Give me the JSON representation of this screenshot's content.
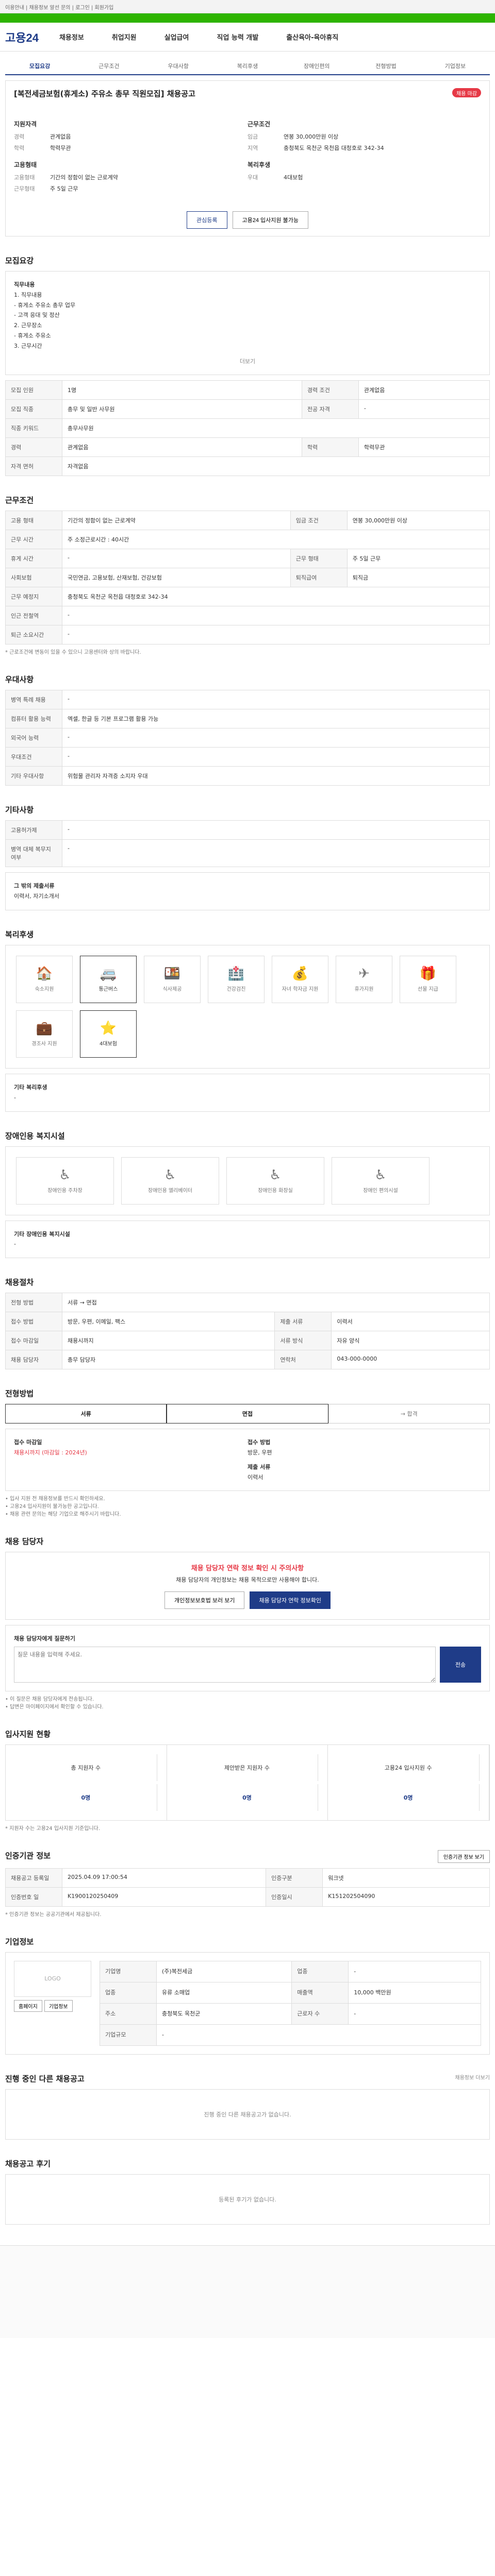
{
  "topbar": {
    "text": "이용안내 | 채용정보 알선 문의 | 로그인 | 회원가입"
  },
  "header": {
    "logo": "고용24",
    "gnb": [
      "채용정보",
      "취업지원",
      "실업급여",
      "직업 능력 개발",
      "출산육아-육아휴직"
    ]
  },
  "tabs": [
    "모집요강",
    "근무조건",
    "우대사항",
    "복리후생",
    "장애인편의",
    "전형방법",
    "기업정보"
  ],
  "job": {
    "title": "[복전세금보험(휴게소) 주유소 총무 직원모집] 채용공고",
    "badge": "채용 마감",
    "summary_left_head": "지원자격",
    "summary_left": [
      {
        "k": "경력",
        "v": "관계없음"
      },
      {
        "k": "학력",
        "v": "학력무관"
      }
    ],
    "summary_right_head": "근무조건",
    "summary_right": [
      {
        "k": "임금",
        "v": "연봉 30,000만원 이상"
      },
      {
        "k": "지역",
        "v": "충청북도 옥천군 옥천읍 대청호로 342-34"
      }
    ],
    "summary_left2_head": "고용형태",
    "summary_left2": [
      {
        "k": "고용형태",
        "v": "기간의 정함이 없는 근로계약"
      },
      {
        "k": "근무형태",
        "v": "주 5일 근무"
      }
    ],
    "summary_right2_head": "복리후생",
    "summary_right2": [
      {
        "k": "우대",
        "v": "4대보험"
      }
    ],
    "btn_save": "관심등록",
    "btn_apply": "고용24 입사지원 불가능"
  },
  "recruit": {
    "title": "모집요강",
    "duties_head": "직무내용",
    "duties": [
      "1. 직무내용",
      "- 휴게소 주유소 총무 업무",
      "- 고객 응대 및 정산",
      "2. 근무장소",
      "- 휴게소 주유소",
      "3. 근무시간"
    ],
    "toggle": "더보기",
    "rows": [
      {
        "k": "모집 인원",
        "v": "1명",
        "k2": "경력 조건",
        "v2": "관계없음"
      },
      {
        "k": "모집 직종",
        "v": "총무 및 일반 사무원",
        "k2": "전공 자격",
        "v2": "-"
      },
      {
        "k": "직종 키워드",
        "v": "총무사무원",
        "k2": "",
        "v2": ""
      },
      {
        "k": "경력",
        "v": "관계없음",
        "k2": "학력",
        "v2": "학력무관"
      },
      {
        "k": "자격 면허",
        "v": "자격없음",
        "k2": "",
        "v2": ""
      }
    ]
  },
  "conditions": {
    "title": "근무조건",
    "rows": [
      {
        "k": "고용 형태",
        "v": "기간의 정함이 없는 근로계약",
        "k2": "임금 조건",
        "v2": "연봉 30,000만원 이상"
      },
      {
        "k": "근무 시간",
        "v": "주 소정근로시간 : 40시간",
        "k2": "",
        "v2": ""
      },
      {
        "k": "휴게 시간",
        "v": "-",
        "k2": "근무 형태",
        "v2": "주 5일 근무"
      },
      {
        "k": "사회보험",
        "v": "국민연금, 고용보험, 산재보험, 건강보험",
        "k2": "퇴직급여",
        "v2": "퇴직금"
      },
      {
        "k": "근무 예정지",
        "v": "충청북도 옥천군 옥천읍 대청호로 342-34",
        "k2": "",
        "v2": ""
      },
      {
        "k": "인근 전철역",
        "v": "-",
        "k2": "",
        "v2": ""
      },
      {
        "k": "퇴근 소요시간",
        "v": "-",
        "k2": "",
        "v2": ""
      }
    ],
    "note": "* 근로조건에 변동이 있을 수 있으니 고용센터와 상의 바랍니다."
  },
  "prefer": {
    "title": "우대사항",
    "rows": [
      {
        "k": "병역 특례 채용",
        "v": "-"
      },
      {
        "k": "컴퓨터 활용 능력",
        "v": "엑셀, 한글 등 기본 프로그램 활용 가능"
      },
      {
        "k": "외국어 능력",
        "v": "-"
      },
      {
        "k": "우대조건",
        "v": "-"
      },
      {
        "k": "기타 우대사항",
        "v": "위험물 관리자 자격증 소지자 우대"
      }
    ]
  },
  "other": {
    "title": "기타사항",
    "rows": [
      {
        "k": "고용허가제",
        "v": "-"
      },
      {
        "k": "병역 대체 복무지 여부",
        "v": "-"
      }
    ],
    "box_head": "그 밖의 제출서류",
    "box_text": "이력서, 자기소개서"
  },
  "welfare": {
    "title": "복리후생",
    "items": [
      {
        "icon": "🏠",
        "label": "숙소지원",
        "on": false
      },
      {
        "icon": "🚐",
        "label": "통근버스",
        "on": true
      },
      {
        "icon": "🍱",
        "label": "식사제공",
        "on": false
      },
      {
        "icon": "🏥",
        "label": "건강검진",
        "on": false
      },
      {
        "icon": "💰",
        "label": "자녀 학자금 지원",
        "on": false
      },
      {
        "icon": "✈",
        "label": "휴가지원",
        "on": false
      },
      {
        "icon": "🎁",
        "label": "선물 지급",
        "on": false
      },
      {
        "icon": "💼",
        "label": "경조사 지원",
        "on": false
      },
      {
        "icon": "⭐",
        "label": "4대보험",
        "on": true
      }
    ],
    "box_head": "기타 복리후생",
    "box_text": "-"
  },
  "access": {
    "title": "장애인용 복지시설",
    "items": [
      "장애인용 주차장",
      "장애인용 엘리베이터",
      "장애인용 화장실",
      "장애인 편의시설"
    ],
    "box_head": "기타 장애인용 복지시설",
    "box_text": "-"
  },
  "process": {
    "title": "채용절차",
    "rows": [
      {
        "k": "전형 방법",
        "v": "서류 → 면접",
        "k2": "",
        "v2": ""
      },
      {
        "k": "접수 방법",
        "v": "방문, 우편, 이메일, 팩스",
        "k2": "제출 서류",
        "v2": "이력서"
      },
      {
        "k": "접수 마감일",
        "v": "채용시까지",
        "k2": "서류 방식",
        "v2": "자유 양식"
      },
      {
        "k": "채용 담당자",
        "v": "총무 담당자",
        "k2": "연락처",
        "v2": "043-000-0000"
      }
    ]
  },
  "apply": {
    "title": "전형방법",
    "toggle": [
      "서류",
      "면접",
      "→ 합격"
    ],
    "deadline_head": "접수 마감일",
    "deadline": "채용시까지 (마감일 : 2024년)",
    "method_head": "접수 방법",
    "method": "방문, 우편",
    "doc_head": "제출 서류",
    "doc": "이력서",
    "notes": [
      "• 입사 지원 전 채용정보를 반드시 확인하세요.",
      "• 고용24 입사지원이 불가능한 공고입니다.",
      "• 채용 관련 문의는 해당 기업으로 해주시기 바랍니다."
    ]
  },
  "contact": {
    "title": "채용 담당자",
    "alert_red": "채용 담당자 연락 정보 확인 시 주의사항",
    "alert_text": "채용 담당자의 개인정보는 채용 목적으로만 사용해야 합니다.",
    "btn1": "개인정보보호법 보러 보기",
    "btn2": "채용 담당자 연락 정보확인",
    "qa_head": "채용 담당자에게 질문하기",
    "qa_placeholder": "질문 내용을 입력해 주세요.",
    "qa_btn": "전송",
    "notes": [
      "• 이 질문은 채용 담당자에게 전송됩니다.",
      "• 답변은 마이페이지에서 확인할 수 있습니다."
    ]
  },
  "stats": {
    "title": "입사지원 현황",
    "items": [
      {
        "label": "총 지원자 수",
        "value": "0명"
      },
      {
        "label": "제안받은 지원자 수",
        "value": "0명"
      },
      {
        "label": "고용24 입사지원 수",
        "value": "0명"
      }
    ],
    "note": "* 지원자 수는 고용24 입사지원 기준입니다."
  },
  "org": {
    "title": "인증기관 정보",
    "btn": "인증기관 정보 보기",
    "rows": [
      {
        "k": "채용공고 등록일",
        "v": "2025.04.09 17:00:54",
        "k2": "인증구분",
        "v2": "워크넷"
      },
      {
        "k": "인증번호 일",
        "v": "K1900120250409",
        "k2": "인증일시",
        "v2": "K151202504090"
      }
    ],
    "notes": [
      "* 인증기관 정보는 공공기관에서 제공됩니다."
    ]
  },
  "company": {
    "title": "기업정보",
    "logo_text": "LOGO",
    "btn1": "홈페이지",
    "btn2": "기업정보",
    "rows": [
      {
        "k": "기업명",
        "v": "(주)복전세금",
        "k2": "업종",
        "v2": "-"
      },
      {
        "k": "업종",
        "v": "유류 소매업",
        "k2": "매출액",
        "v2": "10,000 백만원"
      },
      {
        "k": "주소",
        "v": "충청북도 옥천군",
        "k2": "근로자 수",
        "v2": "-"
      },
      {
        "k": "기업규모",
        "v": "-",
        "k2": "",
        "v2": ""
      }
    ]
  },
  "others": {
    "title": "진행 중인 다른 채용공고",
    "link": "채용정보 더보기",
    "empty": "진행 중인 다른 채용공고가 없습니다."
  },
  "review": {
    "title": "채용공고 후기",
    "empty": "등록된 후기가 없습니다."
  }
}
